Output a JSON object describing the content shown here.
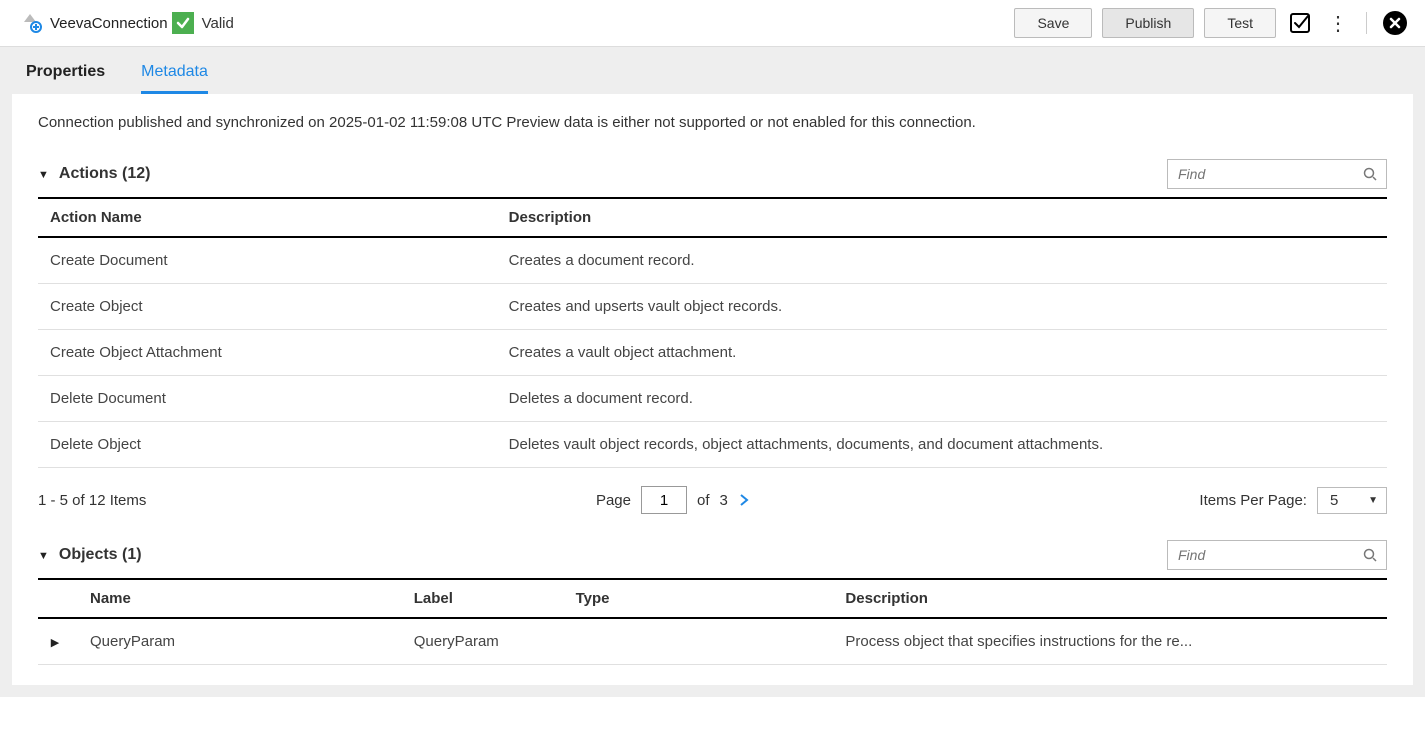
{
  "header": {
    "connection_name": "VeevaConnection",
    "status_text": "Valid",
    "save_label": "Save",
    "publish_label": "Publish",
    "test_label": "Test"
  },
  "tabs": {
    "properties": "Properties",
    "metadata": "Metadata"
  },
  "info_line": "Connection published and synchronized on 2025-01-02 11:59:08 UTC Preview data is either not supported or not enabled for this connection.",
  "actions_section": {
    "title": "Actions (12)",
    "find_placeholder": "Find",
    "columns": {
      "name": "Action Name",
      "description": "Description"
    },
    "rows": [
      {
        "name": "Create Document",
        "description": "Creates a document record."
      },
      {
        "name": "Create Object",
        "description": "Creates and upserts vault object records."
      },
      {
        "name": "Create Object Attachment",
        "description": "Creates a vault object attachment."
      },
      {
        "name": "Delete Document",
        "description": "Deletes a document record."
      },
      {
        "name": "Delete Object",
        "description": "Deletes vault object records, object attachments, documents, and document attachments."
      }
    ]
  },
  "pager": {
    "range_text": "1 - 5 of 12 Items",
    "page_label": "Page",
    "page_value": "1",
    "of_label": "of",
    "total_pages": "3",
    "items_per_page_label": "Items Per Page:",
    "items_per_page_value": "5"
  },
  "objects_section": {
    "title": "Objects (1)",
    "find_placeholder": "Find",
    "columns": {
      "name": "Name",
      "label": "Label",
      "type": "Type",
      "description": "Description"
    },
    "rows": [
      {
        "name": "QueryParam",
        "label": "QueryParam",
        "type": "",
        "description": "Process object that specifies instructions for the re..."
      }
    ]
  }
}
